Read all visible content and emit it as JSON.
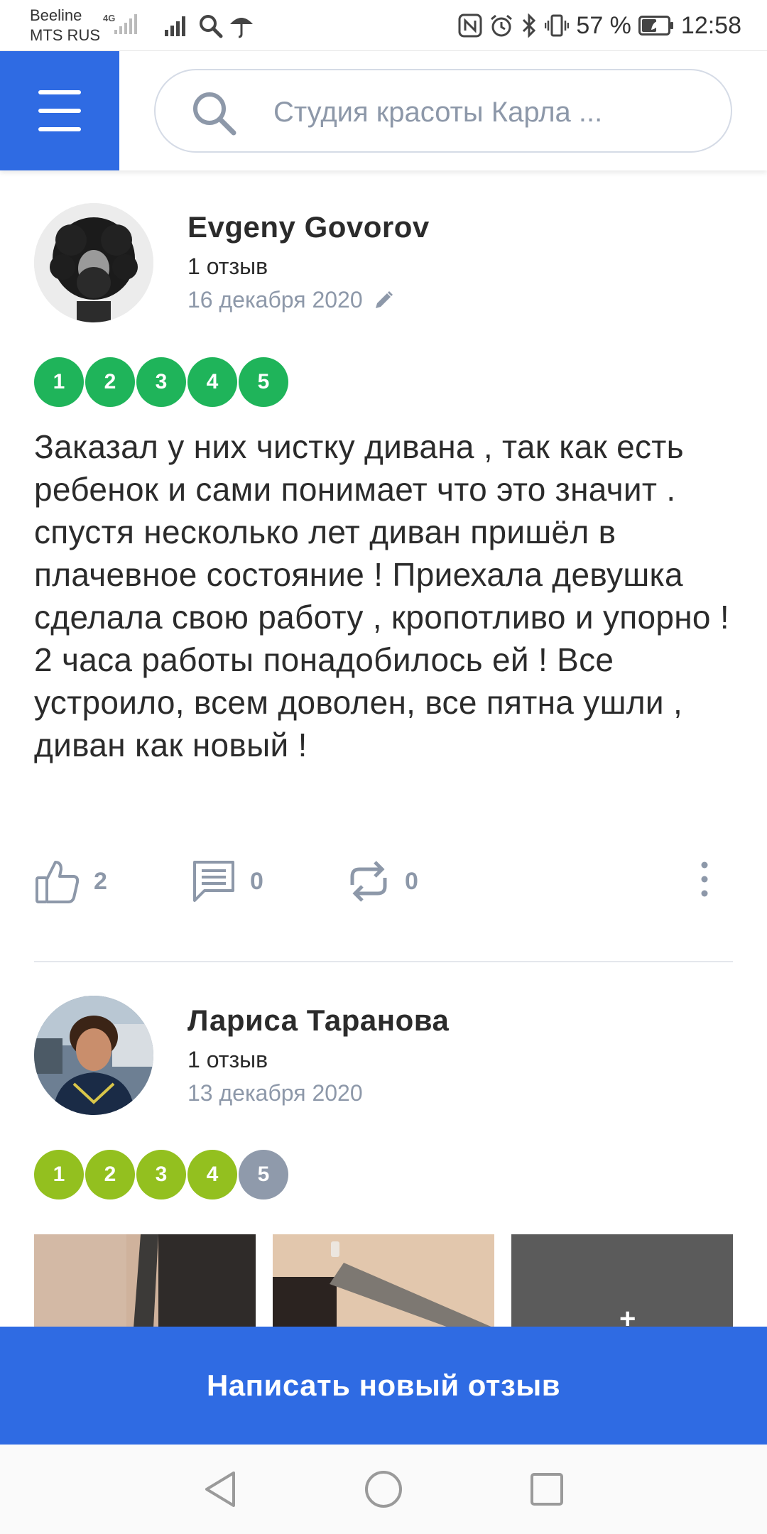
{
  "status_bar": {
    "carrier_1": "Beeline",
    "carrier_2": "MTS RUS",
    "network": "4G",
    "battery_percent": "57 %",
    "battery_level": 0.57,
    "time": "12:58"
  },
  "header": {
    "search_placeholder": "Студия красоты Карла ..."
  },
  "reviews": [
    {
      "author": "Evgeny Govorov",
      "review_count": "1 отзыв",
      "date": "16 декабря 2020",
      "rating_labels": [
        "1",
        "2",
        "3",
        "4",
        "5"
      ],
      "rating_value": 5,
      "rating_color": "#1fb45a",
      "text": "Заказал у них чистку дивана , так как есть ребенок и сами понимает что это значит . спустя несколько лет диван пришёл в плачевное состояние ! Приехала девушка сделала свою работу , кропотливо и упорно ! 2 часа работы понадобилось ей ! Все устроило, всем доволен, все пятна ушли , диван как новый !",
      "likes": "2",
      "comments": "0",
      "reposts": "0"
    },
    {
      "author": "Лариса Таранова",
      "review_count": "1 отзыв",
      "date": "13 декабря 2020",
      "rating_labels": [
        "1",
        "2",
        "3",
        "4",
        "5"
      ],
      "rating_value": 4,
      "rating_color": "#93c01f",
      "rating_inactive_color": "#8f9aab"
    }
  ],
  "cta": {
    "label": "Написать новый отзыв"
  },
  "icons": {
    "menu": "hamburger-icon",
    "search": "search-icon",
    "edit": "pencil-icon",
    "like": "thumbs-up-icon",
    "comment": "comment-icon",
    "repost": "repost-icon",
    "more": "more-vertical-icon",
    "nav_back": "back-triangle-icon",
    "nav_home": "home-circle-icon",
    "nav_recents": "recents-square-icon"
  },
  "colors": {
    "accent": "#2f6be3",
    "muted": "#8d98a9",
    "rating_green": "#1fb45a",
    "rating_lime": "#93c01f"
  }
}
